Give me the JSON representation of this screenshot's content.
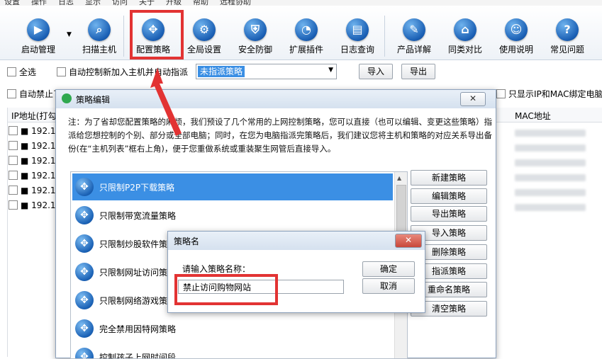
{
  "menubar": [
    "设置",
    "操作",
    "日志",
    "显示",
    "访问",
    "关于",
    "升级",
    "帮助",
    "远程协助"
  ],
  "toolbar": [
    {
      "label": "启动管理",
      "icon": "play-icon",
      "glyph": "▶"
    },
    {
      "label": "扫描主机",
      "icon": "scan-icon",
      "glyph": "⌕"
    },
    {
      "label": "配置策略",
      "icon": "policy-icon",
      "glyph": "✥"
    },
    {
      "label": "全局设置",
      "icon": "gear-icon",
      "glyph": "⚙"
    },
    {
      "label": "安全防御",
      "icon": "shield-icon",
      "glyph": "⛨"
    },
    {
      "label": "扩展插件",
      "icon": "plugin-icon",
      "glyph": "◔"
    },
    {
      "label": "日志查询",
      "icon": "log-icon",
      "glyph": "▤"
    },
    {
      "label": "产品详解",
      "icon": "product-icon",
      "glyph": "✎"
    },
    {
      "label": "同类对比",
      "icon": "compare-icon",
      "glyph": "⌂"
    },
    {
      "label": "使用说明",
      "icon": "manual-icon",
      "glyph": "☺"
    },
    {
      "label": "常见问题",
      "icon": "help-icon",
      "glyph": "?"
    }
  ],
  "filters": {
    "select_all": "全选",
    "auto_assign": "自动控制新加入主机并自动指派",
    "policy_select_value": "未指派策略",
    "import_label": "导入",
    "export_label": "导出",
    "auto_block": "自动禁止了",
    "only_bound": "只显示IP和MAC绑定电脑"
  },
  "table": {
    "col_ip": "IP地址(打勾",
    "col_mac": "MAC地址",
    "rows": [
      "192.1",
      "192.1",
      "192.1",
      "192.1",
      "192.1",
      "192.1"
    ]
  },
  "policy_dialog": {
    "title": "策略编辑",
    "close": "✕",
    "note": "注：为了省却您配置策略的麻烦，我们预设了几个常用的上网控制策略，您可以直接（也可以编辑、变更这些策略）指派给您想控制的个别、部分或全部电脑；同时，在您为电脑指派完策略后，我们建议您将主机和策略的对应关系导出备份(在“主机列表”框右上角)，便于您重做系统或重装聚生网管后直接导入。",
    "policies": [
      "只限制P2P下载策略",
      "只限制带宽流量策略",
      "只限制炒股软件策略",
      "只限制网址访问策略",
      "只限制网络游戏策略",
      "完全禁用因特网策略",
      "控制孩子上网时间段"
    ],
    "buttons": [
      "新建策略",
      "编辑策略",
      "导出策略",
      "导入策略",
      "删除策略",
      "指派策略",
      "重命名策略",
      "清空策略"
    ]
  },
  "name_dialog": {
    "title": "策略名",
    "close": "✕",
    "prompt": "请输入策略名称：",
    "value": "禁止访问购物网站",
    "ok": "确定",
    "cancel": "取消"
  },
  "colors": {
    "highlight": "#e23333",
    "selection": "#3b8fe4",
    "accent": "#1a5fb4"
  }
}
